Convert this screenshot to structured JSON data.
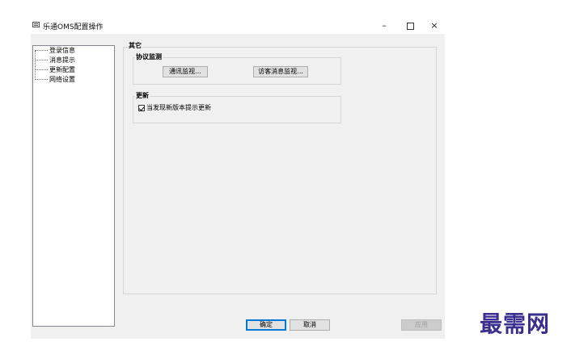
{
  "window": {
    "title": "乐通OMS配置操作",
    "minimize": "–",
    "close": "×"
  },
  "tree": {
    "items": [
      {
        "label": "登录信息"
      },
      {
        "label": "消息提示"
      },
      {
        "label": "更新配置"
      },
      {
        "label": "网络设置"
      }
    ]
  },
  "panel": {
    "title": "其它",
    "protocol_group": {
      "title": "协议监测",
      "comm_button": "通讯监视...",
      "visit_button": "访客消息监视..."
    },
    "update_group": {
      "title": "更新",
      "checkbox_label": "当发现新版本提示更新",
      "checked": true
    }
  },
  "footer": {
    "ok": "确定",
    "cancel": "取消",
    "apply": "应用"
  },
  "watermark": "最需网"
}
